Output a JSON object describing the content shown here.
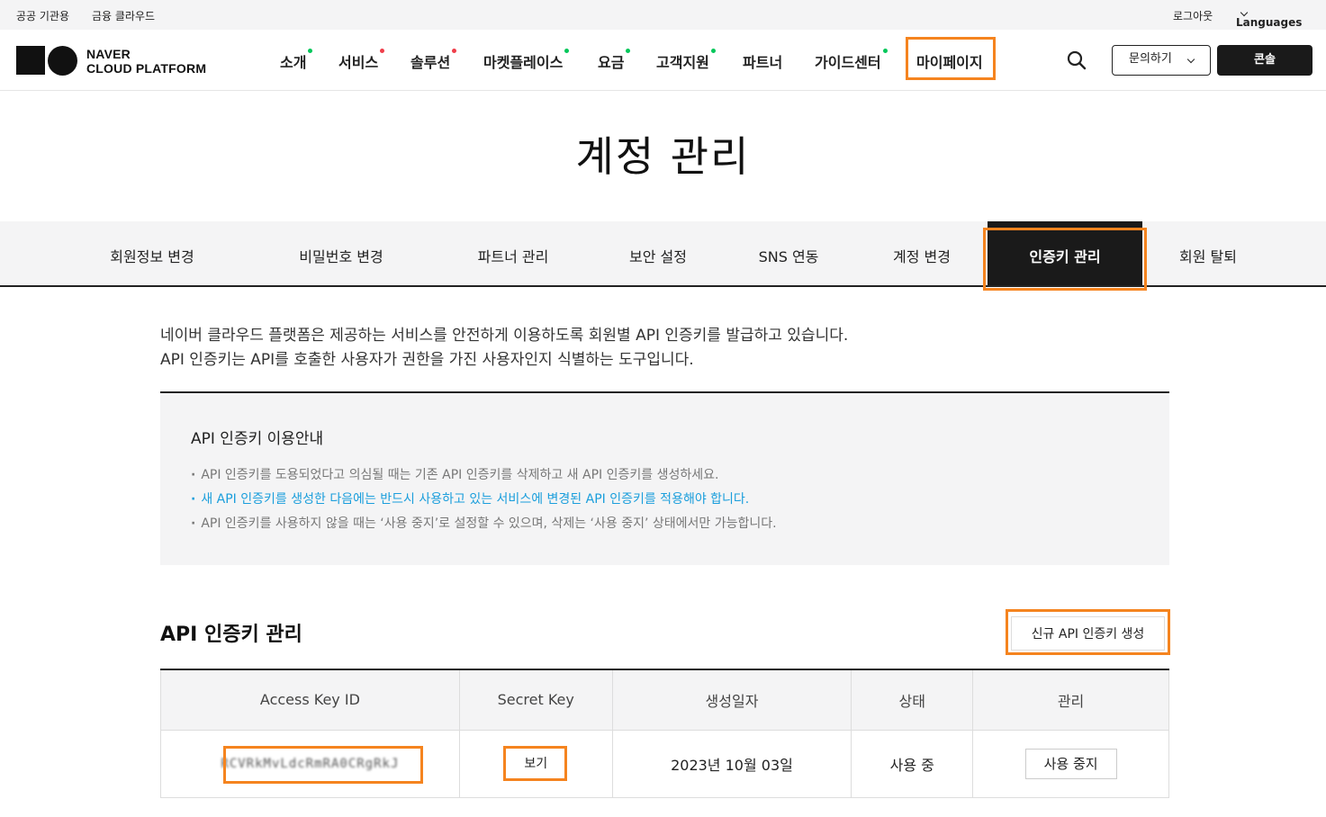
{
  "utility_bar": {
    "public": "공공 기관용",
    "finance": "금융 클라우드",
    "logout": "로그아웃",
    "languages": "Languages"
  },
  "logo": {
    "line1": "NAVER",
    "line2": "CLOUD PLATFORM"
  },
  "nav": [
    {
      "label": "소개",
      "dot": "green"
    },
    {
      "label": "서비스",
      "dot": "red"
    },
    {
      "label": "솔루션",
      "dot": "red"
    },
    {
      "label": "마켓플레이스",
      "dot": "green"
    },
    {
      "label": "요금",
      "dot": "green"
    },
    {
      "label": "고객지원",
      "dot": "green"
    },
    {
      "label": "파트너",
      "dot": ""
    },
    {
      "label": "가이드센터",
      "dot": "green"
    },
    {
      "label": "마이페이지",
      "dot": ""
    }
  ],
  "header_actions": {
    "contact": "문의하기",
    "console": "콘솔"
  },
  "page_title": "계정 관리",
  "tabs": [
    "회원정보 변경",
    "비밀번호 변경",
    "파트너 관리",
    "보안 설정",
    "SNS 연동",
    "계정 변경",
    "인증키 관리",
    "회원 탈퇴"
  ],
  "active_tab": "인증키 관리",
  "intro": [
    "네이버 클라우드 플랫폼은 제공하는 서비스를 안전하게 이용하도록 회원별 API 인증키를 발급하고 있습니다.",
    "API 인증키는 API를 호출한 사용자가 권한을 가진 사용자인지 식별하는 도구입니다."
  ],
  "notice": {
    "title": "API 인증키 이용안내",
    "items": [
      "API 인증키를 도용되었다고 의심될 때는 기존 API 인증키를 삭제하고 새 API 인증키를 생성하세요.",
      "새 API 인증키를 생성한 다음에는 반드시 사용하고 있는 서비스에 변경된 API 인증키를 적용해야 합니다.",
      "API 인증키를 사용하지 않을 때는 ‘사용 중지’로 설정할 수 있으며, 삭제는 ‘사용 중지’ 상태에서만 가능합니다."
    ]
  },
  "section": {
    "title": "API 인증키 관리",
    "new_key_button": "신규 API 인증키 생성"
  },
  "table": {
    "headers": [
      "Access Key ID",
      "Secret Key",
      "생성일자",
      "상태",
      "관리"
    ],
    "rows": [
      {
        "access_key": "RCVRkMvLdcRmRA0CRgRkJ",
        "secret_label": "보기",
        "created": "2023년 10월 03일",
        "status": "사용 중",
        "action": "사용 중지"
      }
    ]
  },
  "colors": {
    "highlight": "#f5841f",
    "dark": "#1a1a1a",
    "accent_blue": "#1a9edc",
    "dot_green": "#03c75a",
    "dot_red": "#ef3e4a"
  }
}
